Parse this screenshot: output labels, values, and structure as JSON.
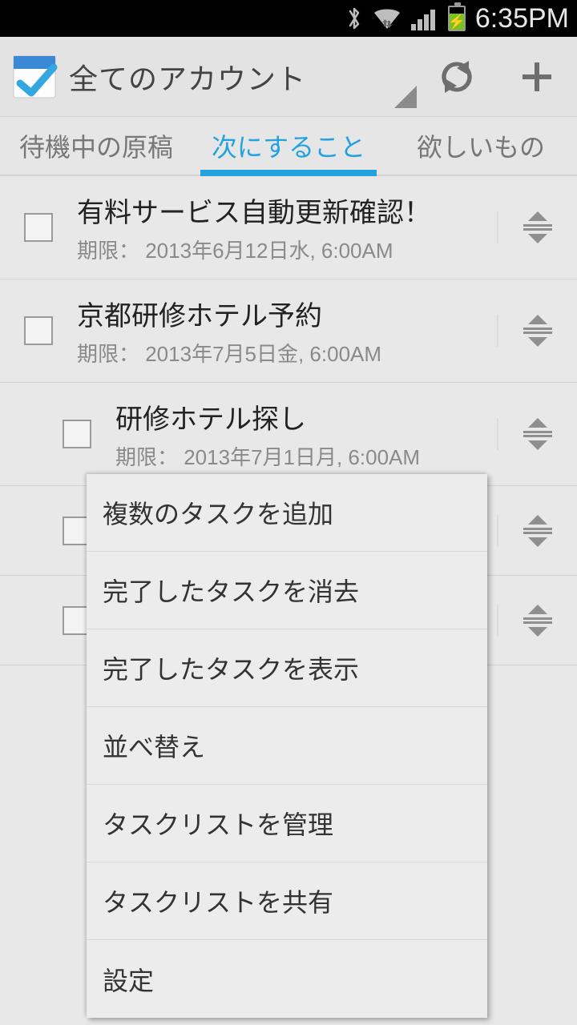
{
  "status": {
    "time": "6:35PM"
  },
  "header": {
    "title": "全てのアカウント"
  },
  "tabs": [
    {
      "label": "待機中の原稿"
    },
    {
      "label": "次にすること"
    },
    {
      "label": "欲しいもの"
    }
  ],
  "tasks": [
    {
      "title": "有料サービス自動更新確認！",
      "due": "期限： 2013年6月12日水, 6:00AM",
      "indent": false
    },
    {
      "title": "京都研修ホテル予約",
      "due": "期限： 2013年7月5日金, 6:00AM",
      "indent": false
    },
    {
      "title": "研修ホテル探し",
      "due": "期限： 2013年7月1日月, 6:00AM",
      "indent": true
    },
    {
      "title": "",
      "due": "",
      "indent": true
    },
    {
      "title": "",
      "due": "",
      "indent": true
    }
  ],
  "menu": {
    "items": [
      "複数のタスクを追加",
      "完了したタスクを消去",
      "完了したタスクを表示",
      "並べ替え",
      "タスクリストを管理",
      "タスクリストを共有",
      "設定"
    ]
  }
}
